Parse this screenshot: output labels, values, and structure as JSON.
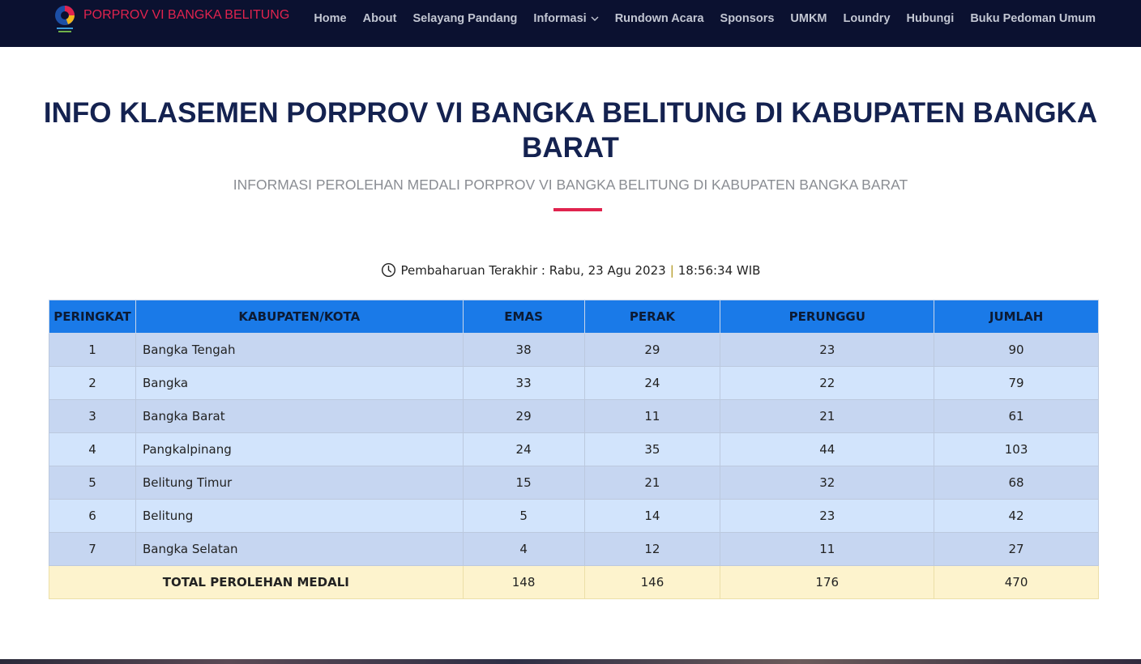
{
  "header": {
    "brand": "PORPROV VI BANGKA BELITUNG",
    "logo_icon": "porprov-logo-icon",
    "nav": [
      {
        "label": "Home"
      },
      {
        "label": "About"
      },
      {
        "label": "Selayang Pandang"
      },
      {
        "label": "Informasi",
        "dropdown": true
      },
      {
        "label": "Rundown Acara"
      },
      {
        "label": "Sponsors"
      },
      {
        "label": "UMKM"
      },
      {
        "label": "Loundry"
      },
      {
        "label": "Hubungi"
      },
      {
        "label": "Buku Pedoman Umum"
      }
    ]
  },
  "main": {
    "title": "INFO KLASEMEN PORPROV VI BANGKA BELITUNG DI KABUPATEN BANGKA BARAT",
    "subtitle": "INFORMASI PEROLEHAN MEDALI PORPROV VI BANGKA BELITUNG DI KABUPATEN BANGKA BARAT",
    "updated_icon": "clock-icon",
    "updated_label": "Pembaharuan Terakhir : Rabu, 23 Agu 2023",
    "updated_separator": "|",
    "updated_time": "18:56:34 WIB"
  },
  "table": {
    "headers": [
      "PERINGKAT",
      "KABUPATEN/KOTA",
      "EMAS",
      "PERAK",
      "PERUNGGU",
      "JUMLAH"
    ],
    "rows": [
      {
        "rank": "1",
        "name": "Bangka Tengah",
        "emas": "38",
        "perak": "29",
        "perunggu": "23",
        "jumlah": "90"
      },
      {
        "rank": "2",
        "name": "Bangka",
        "emas": "33",
        "perak": "24",
        "perunggu": "22",
        "jumlah": "79"
      },
      {
        "rank": "3",
        "name": "Bangka Barat",
        "emas": "29",
        "perak": "11",
        "perunggu": "21",
        "jumlah": "61"
      },
      {
        "rank": "4",
        "name": "Pangkalpinang",
        "emas": "24",
        "perak": "35",
        "perunggu": "44",
        "jumlah": "103"
      },
      {
        "rank": "5",
        "name": "Belitung Timur",
        "emas": "15",
        "perak": "21",
        "perunggu": "32",
        "jumlah": "68"
      },
      {
        "rank": "6",
        "name": "Belitung",
        "emas": "5",
        "perak": "14",
        "perunggu": "23",
        "jumlah": "42"
      },
      {
        "rank": "7",
        "name": "Bangka Selatan",
        "emas": "4",
        "perak": "12",
        "perunggu": "11",
        "jumlah": "27"
      }
    ],
    "total": {
      "label": "TOTAL PEROLEHAN MEDALI",
      "emas": "148",
      "perak": "146",
      "perunggu": "176",
      "jumlah": "470"
    }
  },
  "colors": {
    "navbar_bg": "#0b1130",
    "brand": "#e0234e",
    "title": "#142250",
    "header_row": "#1a7ae8",
    "row_odd": "#c6d6f1",
    "row_even": "#d2e4fc",
    "total_row": "#fdf3cd"
  }
}
